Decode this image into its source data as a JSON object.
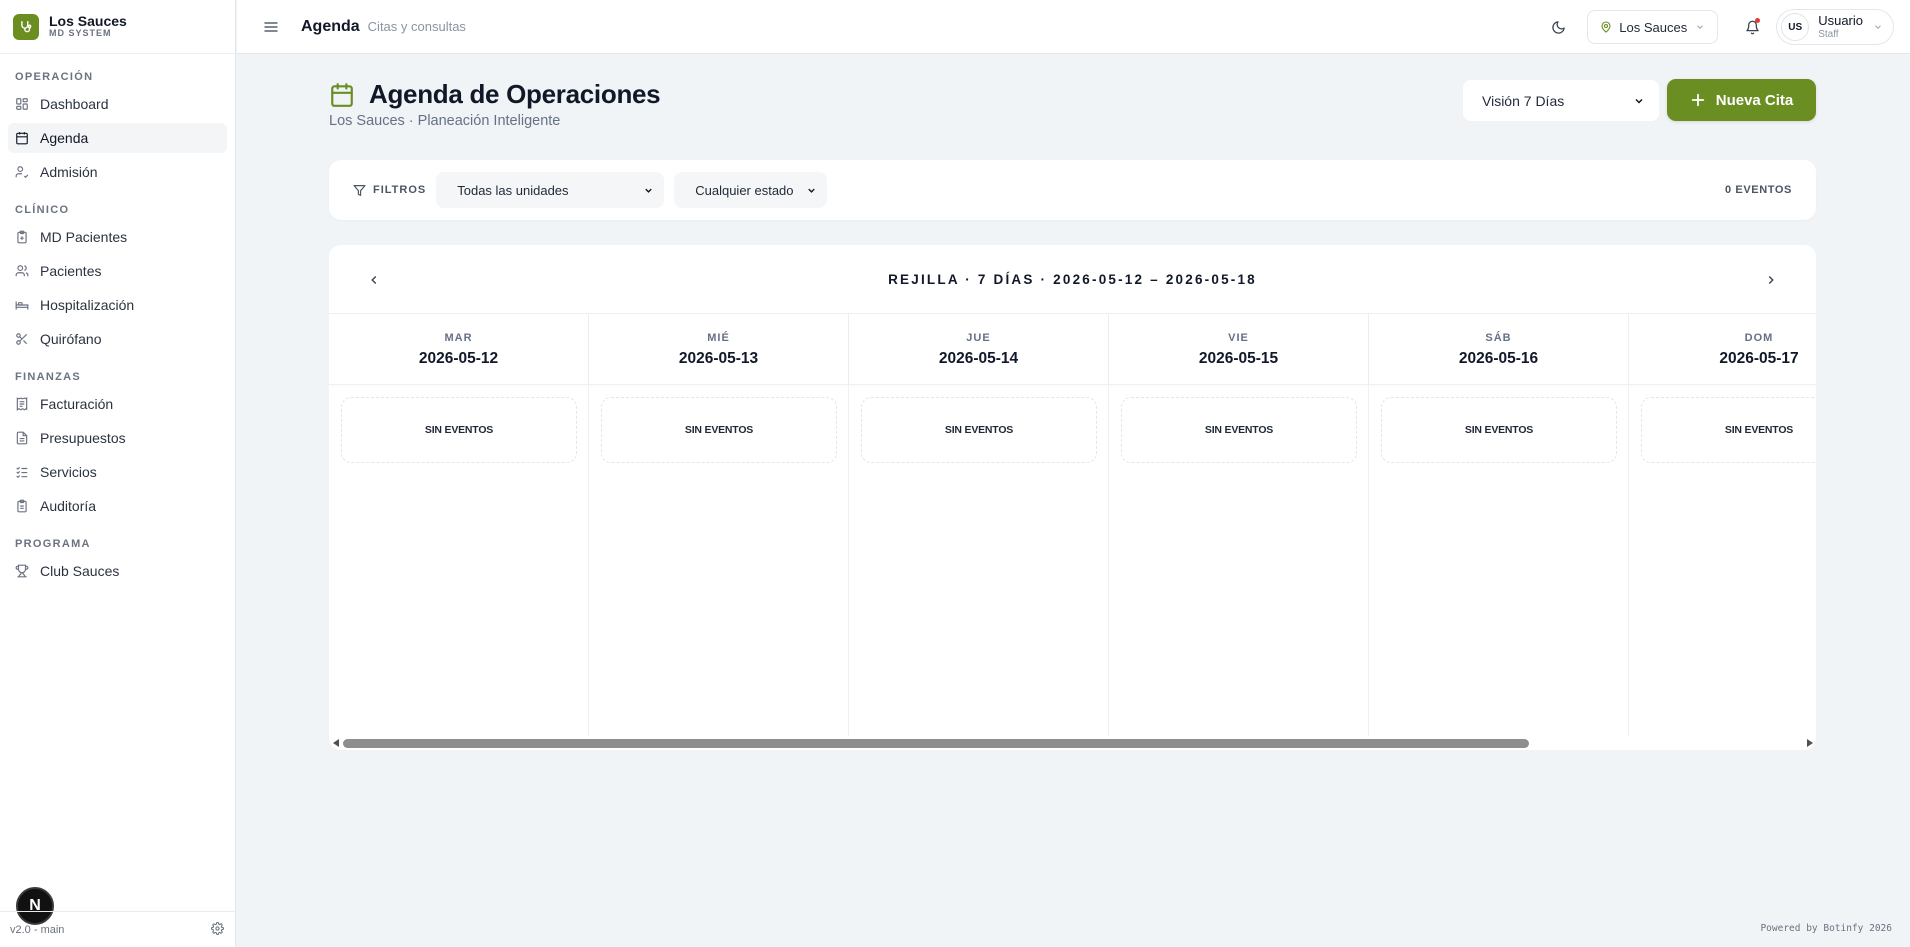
{
  "brand": {
    "name": "Los Sauces",
    "subtitle": "MD SYSTEM"
  },
  "sidebar": {
    "sections": [
      {
        "title": "OPERACIÓN",
        "items": [
          {
            "label": "Dashboard",
            "icon": "dashboard-icon"
          },
          {
            "label": "Agenda",
            "icon": "calendar-icon",
            "active": true
          },
          {
            "label": "Admisión",
            "icon": "user-check-icon"
          }
        ]
      },
      {
        "title": "CLÍNICO",
        "items": [
          {
            "label": "MD Pacientes",
            "icon": "clipboard-icon"
          },
          {
            "label": "Pacientes",
            "icon": "users-icon"
          },
          {
            "label": "Hospitalización",
            "icon": "bed-icon"
          },
          {
            "label": "Quirófano",
            "icon": "scissors-icon"
          }
        ]
      },
      {
        "title": "FINANZAS",
        "items": [
          {
            "label": "Facturación",
            "icon": "receipt-icon"
          },
          {
            "label": "Presupuestos",
            "icon": "document-icon"
          },
          {
            "label": "Servicios",
            "icon": "list-check-icon"
          },
          {
            "label": "Auditoría",
            "icon": "clipboard-list-icon"
          }
        ]
      },
      {
        "title": "PROGRAMA",
        "items": [
          {
            "label": "Club Sauces",
            "icon": "trophy-icon"
          }
        ]
      }
    ],
    "version": "v2.0 - main",
    "dev_badge": "N"
  },
  "topbar": {
    "title": "Agenda",
    "subtitle": "Citas y consultas",
    "location": "Los Sauces",
    "user": {
      "initials": "US",
      "name": "Usuario",
      "role": "Staff"
    }
  },
  "page": {
    "title": "Agenda de Operaciones",
    "subtitle": "Los Sauces · Planeación Inteligente",
    "view_select": "Visión 7 Días",
    "new_button": "Nueva Cita"
  },
  "filters": {
    "label": "FILTROS",
    "units": "Todas las unidades",
    "status": "Cualquier estado",
    "events_count": "0 EVENTOS"
  },
  "calendar": {
    "range_label": "REJILLA · 7 DÍAS · 2026-05-12 – 2026-05-18",
    "days": [
      {
        "name": "MAR",
        "date": "2026-05-12",
        "empty": "SIN EVENTOS"
      },
      {
        "name": "MIÉ",
        "date": "2026-05-13",
        "empty": "SIN EVENTOS"
      },
      {
        "name": "JUE",
        "date": "2026-05-14",
        "empty": "SIN EVENTOS"
      },
      {
        "name": "VIE",
        "date": "2026-05-15",
        "empty": "SIN EVENTOS"
      },
      {
        "name": "SÁB",
        "date": "2026-05-16",
        "empty": "SIN EVENTOS"
      },
      {
        "name": "DOM",
        "date": "2026-05-17",
        "empty": "SIN EVENTOS"
      }
    ]
  },
  "footer": {
    "powered": "Powered by Botinfy 2026"
  },
  "colors": {
    "accent": "#6b8e23",
    "background": "#f1f4f7",
    "notification": "#e53935"
  }
}
